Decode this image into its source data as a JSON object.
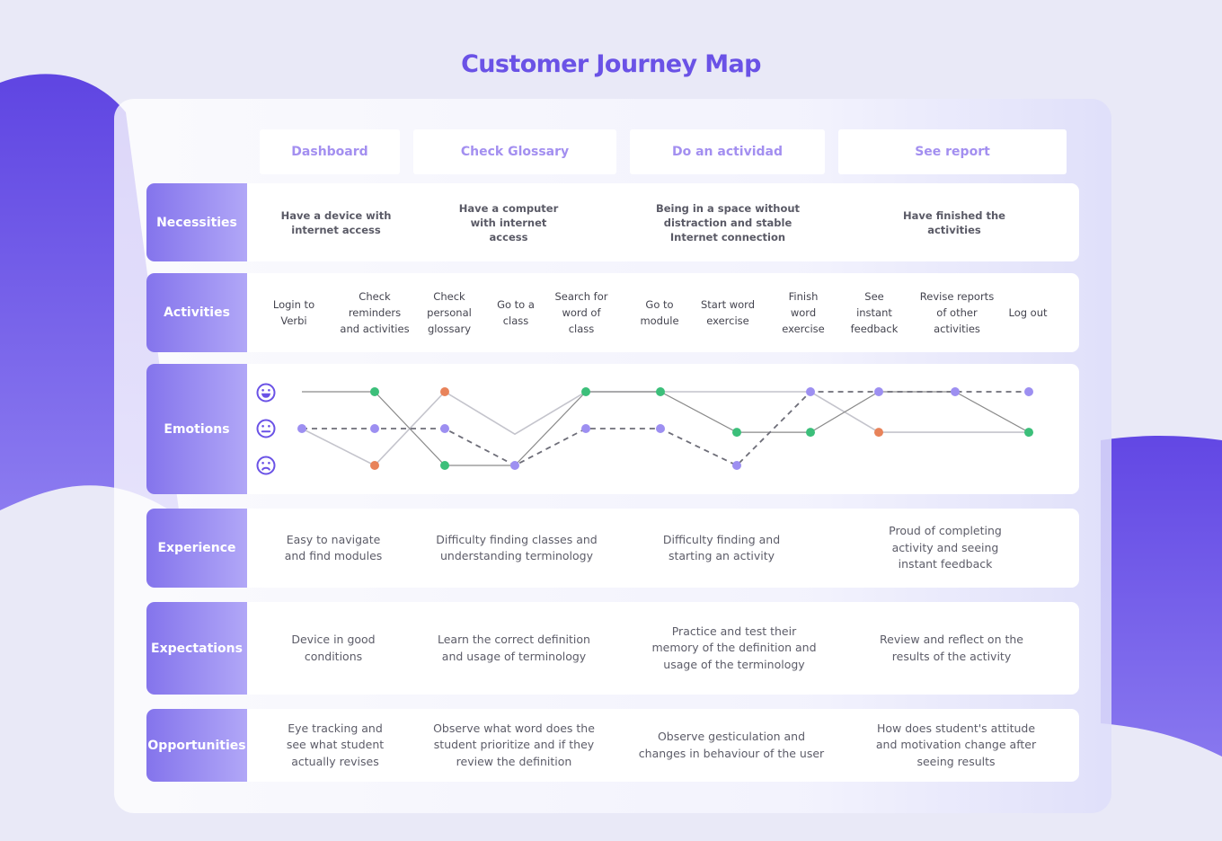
{
  "title": "Customer Journey Map",
  "stages": [
    "Dashboard",
    "Check Glossary",
    "Do an actividad",
    "See report"
  ],
  "rows": {
    "necessities": {
      "label": "Necessities",
      "cells": [
        "Have a device with\ninternet access",
        "Have a computer\nwith internet\naccess",
        "Being in a space without\ndistraction and stable\nInternet connection",
        "Have finished the\nactivities"
      ]
    },
    "activities": {
      "label": "Activities",
      "cells": [
        "Login to\nVerbi",
        "Check\nreminders\nand activities",
        "Check\npersonal\nglossary",
        "Go to a\nclass",
        "Search for\nword of\nclass",
        "Go to\nmodule",
        "Start word\nexercise",
        "Finish\nword\nexercise",
        "See\ninstant\nfeedback",
        "Revise reports\nof other\nactivities",
        "Log out"
      ]
    },
    "emotions": {
      "label": "Emotions",
      "icons": [
        "happy-face",
        "neutral-face",
        "sad-face"
      ]
    },
    "experience": {
      "label": "Experience",
      "cells": [
        "Easy to navigate\nand find modules",
        "Difficulty finding classes and\nunderstanding terminology",
        "Difficulty finding and\nstarting an activity",
        "Proud of completing\nactivity and seeing\ninstant feedback"
      ]
    },
    "expectations": {
      "label": "Expectations",
      "cells": [
        "Device in good\nconditions",
        "Learn the correct definition\nand usage of terminology",
        "Practice and test their\nmemory of the definition and\nusage of the terminology",
        "Review and reflect on the\nresults of the activity"
      ]
    },
    "opportunities": {
      "label": "Opportunities",
      "cells": [
        "Eye tracking and\nsee what student\nactually revises",
        "Observe what word does the\nstudent prioritize and if they\nreview the definition",
        "Observe gesticulation and\nchanges in behaviour of the user",
        "How does student's attitude\nand motivation change after\nseeing results"
      ]
    }
  },
  "chart_data": {
    "type": "line",
    "levels": [
      "happy",
      "neutral",
      "sad"
    ],
    "series": [
      {
        "style": "solid-dark",
        "color": "#8a8a8a",
        "points": [
          {
            "step": 0,
            "level": 2.0,
            "dot": null
          },
          {
            "step": 1,
            "level": 2.0,
            "dot": "#3cbf7a"
          },
          {
            "step": 2,
            "level": 0.0,
            "dot": "#3cbf7a"
          },
          {
            "step": 3,
            "level": 0.0,
            "dot": "#9d8ff1"
          },
          {
            "step": 4,
            "level": 2.0,
            "dot": "#3cbf7a"
          },
          {
            "step": 5,
            "level": 2.0,
            "dot": "#3cbf7a"
          },
          {
            "step": 6,
            "level": 0.9,
            "dot": "#3cbf7a"
          },
          {
            "step": 7,
            "level": 0.9,
            "dot": "#3cbf7a"
          },
          {
            "step": 8,
            "level": 2.0,
            "dot": "#9d8ff1"
          },
          {
            "step": 9,
            "level": 2.0,
            "dot": "#9d8ff1"
          },
          {
            "step": 10,
            "level": 0.9,
            "dot": "#3cbf7a"
          }
        ]
      },
      {
        "style": "solid-light",
        "color": "#c4c4cc",
        "points": [
          {
            "step": 0,
            "level": 1.0,
            "dot": "#9d8ff1"
          },
          {
            "step": 1,
            "level": 0.0,
            "dot": "#e8835a"
          },
          {
            "step": 2,
            "level": 2.0,
            "dot": "#e8835a"
          },
          {
            "step": 3,
            "level": 0.85,
            "dot": null
          },
          {
            "step": 4,
            "level": 2.0,
            "dot": null
          },
          {
            "step": 7,
            "level": 2.0,
            "dot": "#9d8ff1"
          },
          {
            "step": 8,
            "level": 0.9,
            "dot": "#e8835a"
          },
          {
            "step": 10,
            "level": 0.9,
            "dot": null
          }
        ]
      },
      {
        "style": "dashed",
        "color": "#6d6d78",
        "points": [
          {
            "step": 0,
            "level": 1.0,
            "dot": null
          },
          {
            "step": 1,
            "level": 1.0,
            "dot": "#9d8ff1"
          },
          {
            "step": 2,
            "level": 1.0,
            "dot": "#9d8ff1"
          },
          {
            "step": 3,
            "level": 0.0,
            "dot": null
          },
          {
            "step": 4,
            "level": 1.0,
            "dot": "#9d8ff1"
          },
          {
            "step": 5,
            "level": 1.0,
            "dot": "#9d8ff1"
          },
          {
            "step": 6,
            "level": 0.0,
            "dot": "#9d8ff1"
          },
          {
            "step": 7,
            "level": 2.0,
            "dot": null
          },
          {
            "step": 8,
            "level": 2.0,
            "dot": null
          },
          {
            "step": 9,
            "level": 2.0,
            "dot": null
          },
          {
            "step": 10,
            "level": 2.0,
            "dot": "#9d8ff1"
          }
        ]
      }
    ]
  },
  "colors": {
    "accent": "#6a52e6",
    "label_gradient_start": "#8474ec",
    "label_gradient_end": "#b1a7f7",
    "dot_green": "#3cbf7a",
    "dot_orange": "#e8835a",
    "dot_purple": "#9d8ff1"
  }
}
